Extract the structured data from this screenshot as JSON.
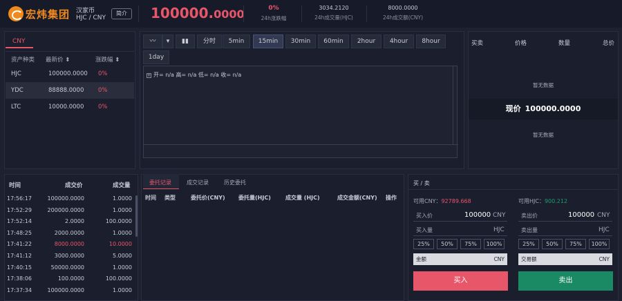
{
  "header": {
    "logo_text": "宏炜集团",
    "coin_name": "汉家币",
    "pair": "HJC / CNY",
    "intro_label": "简介",
    "price_int": "100000.",
    "price_dec": "0000",
    "change": "0%",
    "change_label": "24h涨跌幅",
    "volume": "3034.2120",
    "volume_label": "24h成交量(HJC)",
    "amount": "8000.0000",
    "amount_label": "24h成交额(CNY)"
  },
  "market": {
    "tab": "CNY",
    "headers": {
      "asset": "资产种类",
      "price": "最新价",
      "change": "涨跌幅"
    },
    "sort_icon": "sort-icon",
    "rows": [
      {
        "asset": "HJC",
        "price": "100000.0000",
        "change": "0%"
      },
      {
        "asset": "YDC",
        "price": "88888.0000",
        "change": "0%"
      },
      {
        "asset": "LTC",
        "price": "10000.0000",
        "change": "0%"
      }
    ]
  },
  "chart": {
    "buttons": [
      "分时",
      "5min",
      "15min",
      "30min",
      "60min",
      "2hour",
      "4hour",
      "8hour",
      "1day"
    ],
    "active": "15min",
    "ohlc": "开= n/a 高= n/a 低= n/a 收= n/a"
  },
  "orderbook": {
    "headers": {
      "side": "买卖",
      "price": "价格",
      "qty": "数量",
      "total": "总价"
    },
    "no_data": "暂无数据",
    "current_label": "现价",
    "current_price": "100000.0000"
  },
  "trades": {
    "headers": {
      "time": "时间",
      "price": "成交价",
      "qty": "成交量"
    },
    "rows": [
      {
        "time": "17:56:17",
        "price": "100000.0000",
        "qty": "1.0000",
        "side": "buy"
      },
      {
        "time": "17:52:29",
        "price": "200000.0000",
        "qty": "1.0000",
        "side": "buy"
      },
      {
        "time": "17:52:14",
        "price": "2.0000",
        "qty": "100.0000",
        "side": "buy"
      },
      {
        "time": "17:48:25",
        "price": "2000.0000",
        "qty": "1.0000",
        "side": "buy"
      },
      {
        "time": "17:41:22",
        "price": "8000.0000",
        "qty": "10.0000",
        "side": "sell"
      },
      {
        "time": "17:41:12",
        "price": "3000.0000",
        "qty": "5.0000",
        "side": "buy"
      },
      {
        "time": "17:40:15",
        "price": "50000.0000",
        "qty": "1.0000",
        "side": "buy"
      },
      {
        "time": "17:38:06",
        "price": "100.0000",
        "qty": "100.0000",
        "side": "buy"
      },
      {
        "time": "17:37:34",
        "price": "100000.0000",
        "qty": "1.0000",
        "side": "buy"
      }
    ]
  },
  "orders": {
    "tabs": [
      "委托记录",
      "成交记录",
      "历史委托"
    ],
    "active_tab": "委托记录",
    "columns": [
      "时间",
      "类型",
      "委托价(CNY)",
      "委托量(HJC)",
      "成交量 (HJC)",
      "成交金额(CNY)",
      "操作"
    ]
  },
  "trade": {
    "title": "买 / 卖",
    "buy": {
      "avail_label": "可用CNY：",
      "avail_value": "92789.668",
      "price_label": "买入价",
      "price_value": "100000",
      "price_unit": "CNY",
      "qty_label": "买入量",
      "qty_unit": "HJC",
      "pcts": [
        "25%",
        "50%",
        "75%",
        "100%"
      ],
      "amount_label": "金额",
      "amount_unit": "CNY",
      "button": "买入"
    },
    "sell": {
      "avail_label": "可用HJC：",
      "avail_value": "900.212",
      "price_label": "卖出价",
      "price_value": "100000",
      "price_unit": "CNY",
      "qty_label": "卖出量",
      "qty_unit": "HJC",
      "pcts": [
        "25%",
        "50%",
        "75%",
        "100%"
      ],
      "amount_label": "交易额",
      "amount_unit": "CNY",
      "button": "卖出"
    }
  },
  "colors": {
    "up": "#e8566a",
    "down": "#1d9e6e",
    "brand": "#f08a1c"
  }
}
